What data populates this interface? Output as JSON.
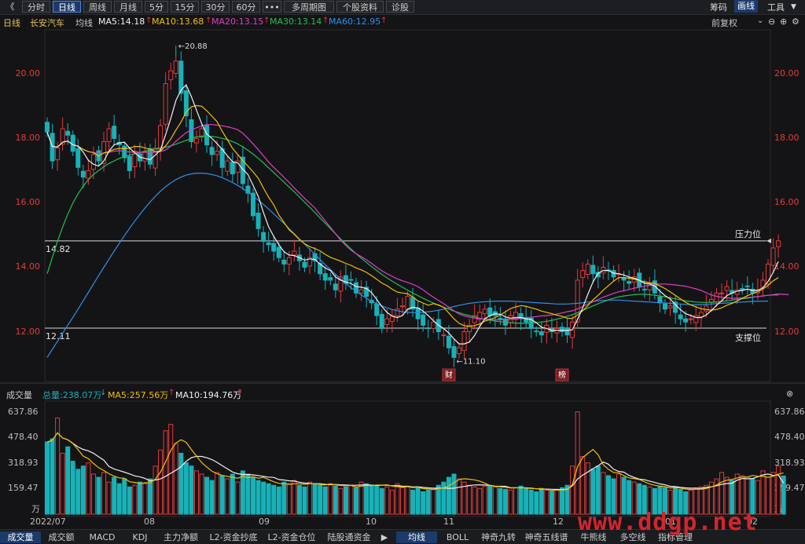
{
  "toolbar": {
    "back": "《",
    "buttons": [
      "分时",
      "日线",
      "周线",
      "月线",
      "5分",
      "15分",
      "30分",
      "60分",
      "•••",
      "多周期图",
      "个股资料",
      "诊股"
    ],
    "active": "日线",
    "right": [
      "筹码",
      "画线",
      "工具"
    ],
    "right_active": "画线"
  },
  "info": {
    "period": "日线",
    "stock": "长安汽车",
    "line_label": "均线",
    "ma5": "MA5:14.18",
    "ma10": "MA10:13.68",
    "ma20": "MA20:13.15",
    "ma30": "MA30:13.14",
    "ma60": "MA60:12.95",
    "fq": "前复权"
  },
  "colors": {
    "up": "#e03a3a",
    "down": "#17b2b8",
    "ma5": "#f0f0f0",
    "ma10": "#f0c000",
    "ma20": "#e03dc8",
    "ma30": "#22c050",
    "ma60": "#2f8fe6",
    "vol_ma5": "#f0c000",
    "vol_ma10": "#f0f0f0"
  },
  "price_axis": {
    "ticks": [
      "20.00",
      "18.00",
      "16.00",
      "14.00",
      "12.00"
    ]
  },
  "annotations": {
    "high": "20.88",
    "low": "11.10",
    "resistance_value": "14.82",
    "resistance_label": "压力位",
    "support_value": "12.11",
    "support_label": "支撑位",
    "tag1": "财",
    "tag2": "榜"
  },
  "volume": {
    "title": "成交量",
    "total": "总量:238.07万",
    "ma5": "MA5:257.56万",
    "ma10": "MA10:194.76万",
    "ticks": [
      "637.86",
      "478.40",
      "318.93",
      "159.47"
    ],
    "unit": "万"
  },
  "date_axis": [
    "2022/07",
    "08",
    "09",
    "10",
    "11",
    "12",
    "01",
    "02"
  ],
  "bottom_tabs": [
    "成交量",
    "成交额",
    "MACD",
    "KDJ",
    "主力净额",
    "L2-资金抄底",
    "L2-资金仓位",
    "陆股通资金",
    "均线",
    "BOLL",
    "神奇九转",
    "神奇五线谱",
    "牛熊线",
    "多空线",
    "指标管理"
  ],
  "bottom_active": [
    "成交量",
    "均线"
  ],
  "watermark": "www.ddgp.net",
  "chart_data": {
    "type": "candlestick",
    "period": "daily",
    "ylim": [
      10.6,
      21.2
    ],
    "levels": {
      "resistance": 14.82,
      "support": 12.11
    },
    "max": 20.88,
    "min": 11.1,
    "closes": [
      18.2,
      17.3,
      17.7,
      18.3,
      18.1,
      17.6,
      17.1,
      16.8,
      17.0,
      17.5,
      17.3,
      17.9,
      18.3,
      18.0,
      17.8,
      17.4,
      17.0,
      17.6,
      17.3,
      17.6,
      17.2,
      17.7,
      18.4,
      19.7,
      20.1,
      20.4,
      19.4,
      18.7,
      17.9,
      18.0,
      18.3,
      17.8,
      17.5,
      17.6,
      17.1,
      17.3,
      16.9,
      17.3,
      16.6,
      16.3,
      15.6,
      15.2,
      14.8,
      14.7,
      14.5,
      14.3,
      14.1,
      14.3,
      14.5,
      14.2,
      14.0,
      14.3,
      14.2,
      13.8,
      13.6,
      13.6,
      13.3,
      13.7,
      13.5,
      13.6,
      13.2,
      13.3,
      13.1,
      12.9,
      12.5,
      12.1,
      12.4,
      12.5,
      12.7,
      12.8,
      13.1,
      12.7,
      12.4,
      12.2,
      12.1,
      12.3,
      12.0,
      11.9,
      11.5,
      11.2,
      11.5,
      12.0,
      12.2,
      12.5,
      12.6,
      12.7,
      12.5,
      12.5,
      12.4,
      12.2,
      12.5,
      12.6,
      12.4,
      12.3,
      12.1,
      12.0,
      11.9,
      12.2,
      12.0,
      12.1,
      12.0,
      11.9,
      12.3,
      13.6,
      13.9,
      14.1,
      13.8,
      13.7,
      14.0,
      13.9,
      13.7,
      13.8,
      13.6,
      13.5,
      13.7,
      13.4,
      13.3,
      13.5,
      13.2,
      12.9,
      12.7,
      12.8,
      12.6,
      12.4,
      12.3,
      12.4,
      12.5,
      12.6,
      12.8,
      13.0,
      13.2,
      13.2,
      13.4,
      13.2,
      13.3,
      13.3,
      13.4,
      13.2,
      13.3,
      13.6,
      14.1,
      14.6,
      14.82
    ],
    "ma5": [
      18.2,
      17.75,
      17.73,
      17.88,
      17.92,
      17.8,
      17.76,
      17.58,
      17.32,
      17.2,
      17.14,
      17.3,
      17.6,
      17.8,
      17.86,
      17.88,
      17.7,
      17.56,
      17.42,
      17.38,
      17.34,
      17.48,
      17.64,
      18.12,
      18.62,
      19.18,
      19.5,
      19.66,
      19.3,
      18.88,
      18.46,
      18.14,
      18.0,
      17.84,
      17.66,
      17.46,
      17.28,
      17.24,
      17.04,
      16.88,
      16.54,
      16.2,
      15.7,
      15.26,
      14.96,
      14.7,
      14.48,
      14.38,
      14.36,
      14.3,
      14.22,
      14.26,
      14.24,
      14.1,
      13.98,
      13.9,
      13.7,
      13.6,
      13.54,
      13.5,
      13.4,
      13.38,
      13.34,
      13.22,
      13.0,
      12.78,
      12.6,
      12.48,
      12.44,
      12.5,
      12.7,
      12.76,
      12.74,
      12.64,
      12.5,
      12.34,
      12.2,
      12.1,
      11.96,
      11.78,
      11.62,
      11.62,
      11.68,
      11.88,
      12.16,
      12.4,
      12.5,
      12.56,
      12.54,
      12.46,
      12.42,
      12.44,
      12.44,
      12.4,
      12.38,
      12.28,
      12.14,
      12.1,
      12.04,
      12.04,
      12.04,
      12.04,
      12.06,
      12.38,
      12.74,
      13.16,
      13.54,
      13.82,
      13.9,
      13.9,
      13.82,
      13.8,
      13.76,
      13.7,
      13.66,
      13.6,
      13.5,
      13.48,
      13.42,
      13.26,
      13.12,
      13.02,
      12.84,
      12.68,
      12.56,
      12.5,
      12.44,
      12.44,
      12.52,
      12.66,
      12.82,
      12.96,
      13.12,
      13.2,
      13.26,
      13.28,
      13.32,
      13.28,
      13.28,
      13.36,
      13.56,
      13.84,
      14.18
    ],
    "ma10": [
      18.2,
      17.75,
      17.73,
      17.88,
      17.92,
      17.8,
      17.76,
      17.66,
      17.59,
      17.56,
      17.45,
      17.55,
      17.59,
      17.66,
      17.69,
      17.68,
      17.7,
      17.75,
      17.75,
      17.7,
      17.67,
      17.59,
      17.6,
      17.77,
      17.98,
      18.26,
      18.51,
      18.82,
      18.98,
      19.02,
      19.0,
      18.86,
      18.69,
      18.52,
      18.22,
      17.96,
      17.69,
      17.5,
      17.31,
      17.14,
      16.96,
      16.76,
      16.46,
      16.18,
      15.94,
      15.62,
      15.39,
      15.16,
      15.02,
      14.86,
      14.73,
      14.64,
      14.58,
      14.51,
      14.4,
      14.31,
      14.25,
      14.19,
      14.12,
      14.06,
      13.98,
      13.92,
      13.84,
      13.74,
      13.63,
      13.51,
      13.43,
      13.32,
      13.23,
      13.2,
      13.18,
      13.08,
      12.96,
      12.89,
      12.82,
      12.87,
      12.83,
      12.76,
      12.58,
      12.4,
      12.26,
      12.19,
      12.16,
      12.19,
      12.24,
      12.33,
      12.38,
      12.44,
      12.52,
      12.62,
      12.72,
      12.77,
      12.81,
      12.79,
      12.74,
      12.7,
      12.64,
      12.6,
      12.56,
      12.51,
      12.48,
      12.42,
      12.41,
      12.52,
      12.65,
      12.81,
      12.99,
      13.13,
      13.29,
      13.43,
      13.57,
      13.68,
      13.68,
      13.66,
      13.63,
      13.59,
      13.55,
      13.52,
      13.5,
      13.42,
      13.34,
      13.24,
      13.13,
      13.02,
      12.91,
      12.83,
      12.77,
      12.71,
      12.69,
      12.67,
      12.69,
      12.74,
      12.82,
      12.88,
      12.95,
      13.04,
      13.12,
      13.18,
      13.24,
      13.32,
      13.44,
      13.58,
      13.68
    ],
    "ma20": [
      18.2,
      17.75,
      17.73,
      17.88,
      17.92,
      17.8,
      17.76,
      17.66,
      17.59,
      17.56,
      17.54,
      17.54,
      17.57,
      17.6,
      17.62,
      17.6,
      17.58,
      17.58,
      17.57,
      17.57,
      17.57,
      17.57,
      17.59,
      17.64,
      17.76,
      17.91,
      18.05,
      18.18,
      18.26,
      18.33,
      18.39,
      18.43,
      18.43,
      18.41,
      18.39,
      18.36,
      18.32,
      18.27,
      18.16,
      18.0,
      17.83,
      17.65,
      17.46,
      17.27,
      17.1,
      16.95,
      16.79,
      16.63,
      16.46,
      16.3,
      16.14,
      15.99,
      15.84,
      15.64,
      15.44,
      15.24,
      15.04,
      14.84,
      14.68,
      14.53,
      14.42,
      14.33,
      14.23,
      14.12,
      14.0,
      13.89,
      13.8,
      13.72,
      13.64,
      13.58,
      13.53,
      13.47,
      13.4,
      13.3,
      13.18,
      13.07,
      12.97,
      12.87,
      12.76,
      12.65,
      12.55,
      12.49,
      12.45,
      12.42,
      12.41,
      12.39,
      12.38,
      12.37,
      12.37,
      12.37,
      12.38,
      12.4,
      12.42,
      12.44,
      12.45,
      12.47,
      12.49,
      12.5,
      12.52,
      12.55,
      12.58,
      12.62,
      12.65,
      12.71,
      12.78,
      12.86,
      12.93,
      13.0,
      13.07,
      13.13,
      13.19,
      13.24,
      13.27,
      13.31,
      13.35,
      13.38,
      13.41,
      13.44,
      13.47,
      13.48,
      13.48,
      13.47,
      13.45,
      13.43,
      13.41,
      13.37,
      13.33,
      13.28,
      13.21,
      13.14,
      13.1,
      13.07,
      13.05,
      13.04,
      13.04,
      13.05,
      13.06,
      13.07,
      13.09,
      13.11,
      13.13,
      13.15,
      13.17,
      13.16,
      13.15
    ],
    "ma30": [
      13.8,
      14.3,
      14.8,
      15.25,
      15.65,
      16.0,
      16.28,
      16.52,
      16.72,
      16.88,
      17.0,
      17.12,
      17.22,
      17.3,
      17.38,
      17.44,
      17.48,
      17.52,
      17.56,
      17.6,
      17.64,
      17.67,
      17.7,
      17.73,
      17.77,
      17.82,
      17.88,
      17.94,
      18.0,
      18.05,
      18.07,
      18.07,
      18.06,
      18.04,
      18.0,
      17.96,
      17.9,
      17.83,
      17.74,
      17.63,
      17.51,
      17.38,
      17.24,
      17.09,
      16.94,
      16.79,
      16.64,
      16.49,
      16.34,
      16.18,
      16.02,
      15.86,
      15.7,
      15.53,
      15.37,
      15.2,
      15.04,
      14.88,
      14.72,
      14.57,
      14.42,
      14.28,
      14.15,
      14.02,
      13.9,
      13.78,
      13.67,
      13.57,
      13.47,
      13.38,
      13.29,
      13.2,
      13.12,
      13.04,
      12.96,
      12.89,
      12.82,
      12.76,
      12.7,
      12.64,
      12.59,
      12.54,
      12.5,
      12.46,
      12.42,
      12.39,
      12.36,
      12.33,
      12.31,
      12.29,
      12.28,
      12.27,
      12.26,
      12.26,
      12.27,
      12.28,
      12.3,
      12.32,
      12.35,
      12.39,
      12.43,
      12.48,
      12.53,
      12.59,
      12.66,
      12.73,
      12.8,
      12.87,
      12.93,
      12.99,
      13.04,
      13.08,
      13.11,
      13.13,
      13.15,
      13.16,
      13.16,
      13.15,
      13.13,
      13.11,
      13.08,
      13.05,
      13.02,
      12.99,
      12.96,
      12.94,
      12.92,
      12.91,
      12.91,
      12.91,
      12.92,
      12.94,
      12.96,
      12.98,
      13.0,
      13.02,
      13.04,
      13.07,
      13.09,
      13.11,
      13.13,
      13.14,
      13.14
    ],
    "ma60": [
      11.2,
      11.45,
      11.7,
      11.95,
      12.2,
      12.45,
      12.7,
      12.96,
      13.22,
      13.48,
      13.74,
      14.0,
      14.25,
      14.5,
      14.74,
      14.98,
      15.21,
      15.43,
      15.64,
      15.84,
      16.03,
      16.2,
      16.36,
      16.5,
      16.62,
      16.72,
      16.8,
      16.86,
      16.9,
      16.92,
      16.92,
      16.91,
      16.88,
      16.84,
      16.78,
      16.71,
      16.63,
      16.54,
      16.44,
      16.33,
      16.21,
      16.08,
      15.95,
      15.81,
      15.66,
      15.51,
      15.36,
      15.2,
      15.04,
      14.88,
      14.72,
      14.56,
      14.4,
      14.24,
      14.08,
      13.93,
      13.78,
      13.64,
      13.5,
      13.37,
      13.25,
      13.14,
      13.04,
      12.95,
      12.87,
      12.8,
      12.74,
      12.69,
      12.65,
      12.62,
      12.6,
      12.59,
      12.59,
      12.6,
      12.62,
      12.64,
      12.67,
      12.7,
      12.74,
      12.78,
      12.82,
      12.85,
      12.88,
      12.9,
      12.92,
      12.93,
      12.94,
      12.95,
      12.95,
      12.95,
      12.95,
      12.94,
      12.93,
      12.92,
      12.91,
      12.9,
      12.89,
      12.88,
      12.87,
      12.86,
      12.86,
      12.86,
      12.87,
      12.88,
      12.9,
      12.92,
      12.94,
      12.96,
      12.97,
      12.98,
      12.98,
      12.98,
      12.97,
      12.96,
      12.95,
      12.94,
      12.93,
      12.92,
      12.91,
      12.9,
      12.89,
      12.88,
      12.87,
      12.86,
      12.85,
      12.84,
      12.84,
      12.84,
      12.85,
      12.86,
      12.87,
      12.88,
      12.89,
      12.9,
      12.91,
      12.92,
      12.93,
      12.94,
      12.95,
      12.95,
      12.95
    ],
    "volume_ylim": [
      0,
      700
    ],
    "volumes": [
      450,
      470,
      600,
      380,
      420,
      330,
      280,
      300,
      320,
      250,
      230,
      260,
      200,
      230,
      190,
      220,
      170,
      180,
      200,
      190,
      220,
      300,
      400,
      520,
      560,
      440,
      380,
      320,
      300,
      270,
      250,
      230,
      210,
      260,
      240,
      220,
      250,
      200,
      270,
      250,
      230,
      210,
      200,
      190,
      180,
      170,
      200,
      190,
      210,
      180,
      170,
      200,
      190,
      180,
      170,
      190,
      175,
      160,
      170,
      180,
      165,
      200,
      190,
      175,
      180,
      160,
      170,
      150,
      190,
      165,
      175,
      150,
      165,
      140,
      150,
      160,
      180,
      200,
      230,
      250,
      220,
      200,
      180,
      170,
      160,
      175,
      180,
      170,
      160,
      155,
      150,
      165,
      175,
      160,
      150,
      140,
      160,
      150,
      145,
      155,
      165,
      180,
      300,
      638,
      360,
      320,
      280,
      300,
      260,
      240,
      220,
      250,
      230,
      210,
      200,
      190,
      180,
      170,
      160,
      175,
      165,
      150,
      170,
      155,
      140,
      150,
      160,
      170,
      180,
      200,
      220,
      260,
      230,
      210,
      250,
      240,
      230,
      220,
      210,
      270,
      230,
      260,
      300,
      238.07
    ],
    "volume_ma5": [
      450,
      460,
      507,
      475,
      464,
      440,
      402,
      362,
      346,
      316,
      290,
      272,
      252,
      238,
      226,
      224,
      202,
      198,
      192,
      196,
      196,
      218,
      262,
      326,
      398,
      444,
      464,
      448,
      404,
      362,
      322,
      294,
      268,
      252,
      242,
      236,
      230,
      224,
      236,
      228,
      234,
      224,
      230,
      216,
      202,
      192,
      190,
      186,
      190,
      190,
      186,
      190,
      190,
      186,
      182,
      188,
      183,
      179,
      177,
      179,
      170,
      175,
      179,
      178,
      182,
      181,
      183,
      175,
      172,
      169,
      172,
      166,
      169,
      159,
      157,
      153,
      159,
      164,
      176,
      196,
      216,
      221,
      218,
      214,
      206,
      193,
      179,
      173,
      171,
      168,
      163,
      164,
      166,
      163,
      160,
      158,
      160,
      153,
      151,
      150,
      151,
      153,
      184,
      295,
      353,
      379,
      404,
      370,
      308,
      280,
      260,
      258,
      240,
      226,
      222,
      216,
      202,
      188,
      180,
      175,
      172,
      164,
      165,
      163,
      156,
      154,
      155,
      155,
      160,
      170,
      182,
      200,
      212,
      216,
      226,
      232,
      232,
      242,
      236,
      236,
      230,
      236,
      250,
      257.56
    ],
    "volume_ma10": [
      450,
      460,
      507,
      475,
      464,
      442,
      419,
      404,
      395,
      380,
      358,
      337,
      297,
      282,
      272,
      262,
      251,
      239,
      233,
      223,
      208,
      213,
      220,
      236,
      255,
      274,
      296,
      330,
      352,
      361,
      360,
      352,
      340,
      323,
      302,
      283,
      263,
      252,
      247,
      247,
      245,
      241,
      236,
      231,
      229,
      216,
      213,
      208,
      206,
      199,
      194,
      192,
      190,
      190,
      186,
      184,
      185,
      183,
      182,
      180,
      180,
      182,
      183,
      181,
      179,
      180,
      180,
      177,
      178,
      175,
      174,
      170,
      171,
      167,
      164,
      162,
      162,
      163,
      161,
      162,
      168,
      173,
      178,
      182,
      183,
      182,
      179,
      175,
      174,
      174,
      165,
      165,
      164,
      165,
      162,
      158,
      157,
      156,
      155,
      154,
      153,
      156,
      177,
      219,
      244,
      263,
      284,
      302,
      325,
      312,
      280,
      267,
      262,
      242,
      229,
      219,
      215,
      206,
      198,
      189,
      183,
      174,
      172,
      167,
      164,
      162,
      163,
      161,
      167,
      171,
      177,
      186,
      191,
      193,
      212,
      222,
      221,
      222,
      233,
      245,
      250,
      241,
      245,
      194.76
    ]
  }
}
